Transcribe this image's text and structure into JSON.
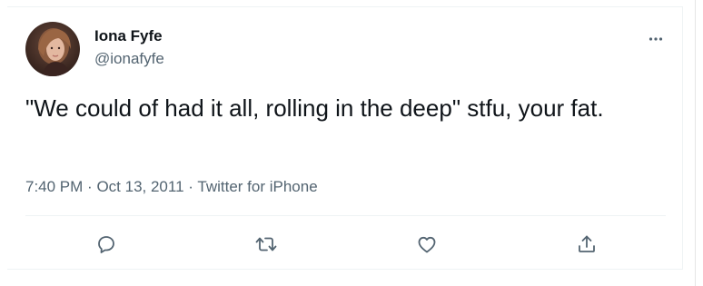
{
  "tweet": {
    "author": {
      "display_name": "Iona Fyfe",
      "handle": "@ionafyfe"
    },
    "text": "\"We could of had it all, rolling in the deep\" stfu, your fat.",
    "meta": {
      "time": "7:40 PM",
      "separator": "·",
      "date": "Oct 13, 2011",
      "source": "Twitter for iPhone"
    }
  },
  "icons": {
    "more": "more-horizontal-icon",
    "reply": "reply-icon",
    "retweet": "retweet-icon",
    "like": "heart-icon",
    "share": "share-icon"
  },
  "colors": {
    "text_primary": "#0f1419",
    "text_secondary": "#536471",
    "divider": "#eff3f4"
  }
}
